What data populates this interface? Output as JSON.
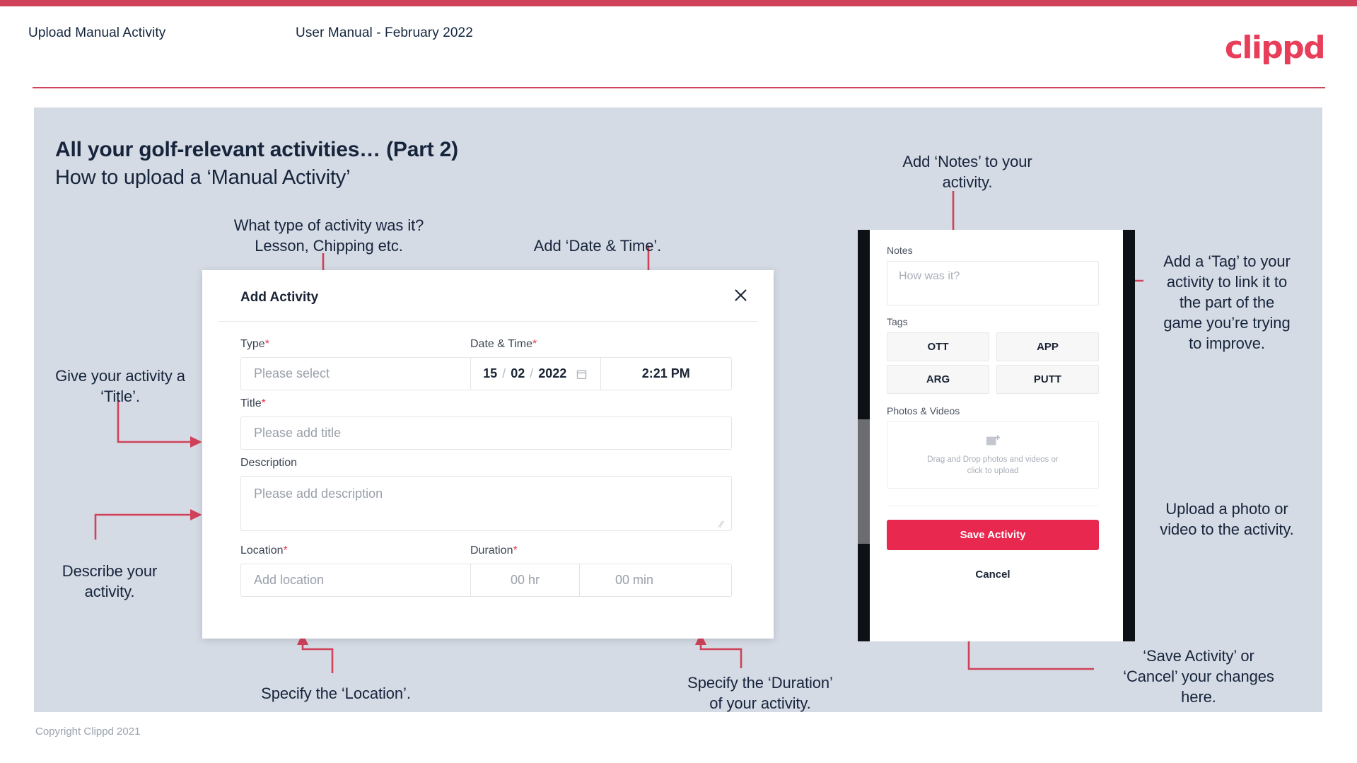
{
  "header": {
    "left_title": "Upload Manual Activity",
    "center_title": "User Manual - February 2022",
    "logo": "clippd"
  },
  "slide": {
    "title": "All your golf-relevant activities… (Part 2)",
    "subtitle": "How to upload a ‘Manual Activity’"
  },
  "footer": {
    "copyright": "Copyright Clippd 2021"
  },
  "annotations": {
    "type": "What type of activity was it?\nLesson, Chipping etc.",
    "datetime": "Add ‘Date & Time’.",
    "title": "Give your activity a\n‘Title’.",
    "description": "Describe your\nactivity.",
    "location": "Specify the ‘Location’.",
    "duration": "Specify the ‘Duration’\nof your activity.",
    "notes": "Add ‘Notes’ to your\nactivity.",
    "tags": "Add a ‘Tag’ to your\nactivity to link it to\nthe part of the\ngame you’re trying\nto improve.",
    "photos": "Upload a photo or\nvideo to the activity.",
    "save_cancel": "‘Save Activity’ or\n‘Cancel’ your changes\nhere."
  },
  "dialog": {
    "title": "Add Activity",
    "close_icon": "close-icon",
    "fields": {
      "type": {
        "label": "Type",
        "required": "*",
        "placeholder": "Please select",
        "icon": "chevron-down-icon"
      },
      "datetime": {
        "label": "Date & Time",
        "required": "*",
        "day": "15",
        "month": "02",
        "year": "2022",
        "sep": "/",
        "calendar_icon": "calendar-icon",
        "time": "2:21 PM"
      },
      "title": {
        "label": "Title",
        "required": "*",
        "placeholder": "Please add title"
      },
      "description": {
        "label": "Description",
        "required": "",
        "placeholder": "Please add description"
      },
      "location": {
        "label": "Location",
        "required": "*",
        "placeholder": "Add location"
      },
      "duration": {
        "label": "Duration",
        "required": "*",
        "hours": "00 hr",
        "minutes": "00 min"
      }
    }
  },
  "phone": {
    "notes": {
      "label": "Notes",
      "placeholder": "How was it?"
    },
    "tags": {
      "label": "Tags",
      "items": [
        "OTT",
        "APP",
        "ARG",
        "PUTT"
      ]
    },
    "photos": {
      "label": "Photos & Videos",
      "icon": "add-image-icon",
      "drop_line1": "Drag and Drop photos and videos or",
      "drop_line2": "click to upload"
    },
    "save_label": "Save Activity",
    "cancel_label": "Cancel"
  },
  "colors": {
    "accent": "#cf4259",
    "brand": "#e8384f",
    "slide_bg": "#d5dbe4",
    "ink": "#16243c"
  }
}
